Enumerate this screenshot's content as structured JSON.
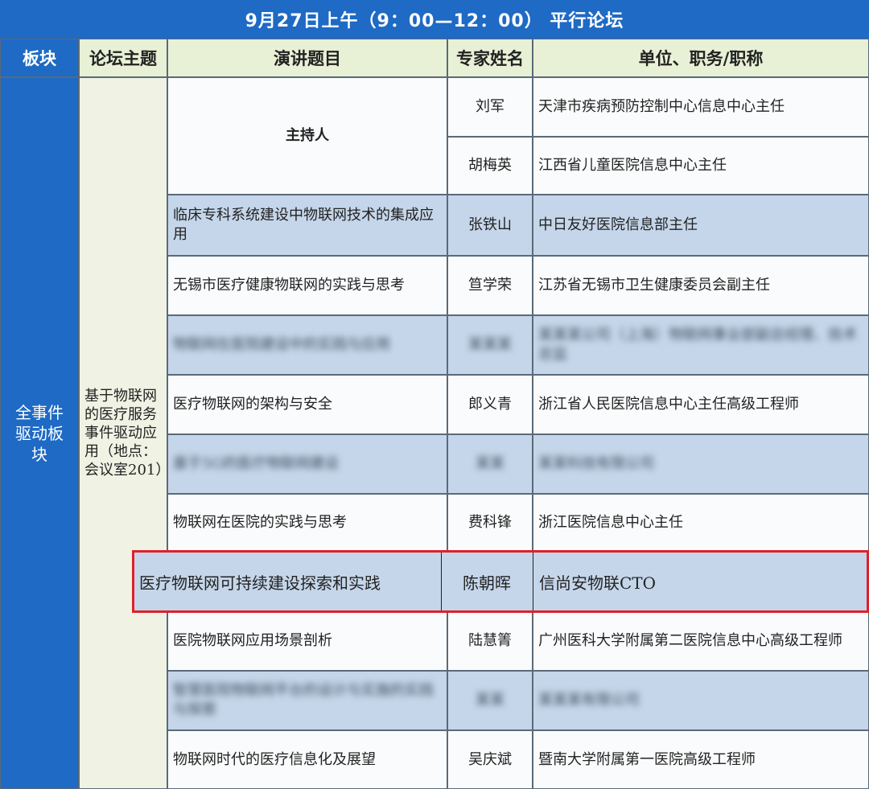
{
  "banner": "9月27日上午（9：00—12：00） 平行论坛",
  "headers": {
    "block": "板块",
    "theme": "论坛主题",
    "talk": "演讲题目",
    "expert": "专家姓名",
    "org": "单位、职务/职称"
  },
  "block_name": "全事件驱动板块",
  "forum_theme": "基于物联网的医疗服务事件驱动应用（地点：会议室201）",
  "host_label": "主持人",
  "rows": [
    {
      "talk": "",
      "name": "刘军",
      "org": "天津市疾病预防控制中心信息中心主任"
    },
    {
      "talk": "",
      "name": "胡梅英",
      "org": "江西省儿童医院信息中心主任"
    },
    {
      "talk": "临床专科系统建设中物联网技术的集成应用",
      "name": "张铁山",
      "org": "中日友好医院信息部主任"
    },
    {
      "talk": "无锡市医疗健康物联网的实践与思考",
      "name": "笪学荣",
      "org": "江苏省无锡市卫生健康委员会副主任"
    },
    {
      "talk": "物联网在医院建设中的实践与应用",
      "name": "某某某",
      "org": "某某某公司（上海）物联网事业部副总经理、技术总监"
    },
    {
      "talk": "医疗物联网的架构与安全",
      "name": "郎义青",
      "org": "浙江省人民医院信息中心主任高级工程师"
    },
    {
      "talk": "基于5G的医疗物联网建设",
      "name": "某某",
      "org": "某某科技有限公司"
    },
    {
      "talk": "物联网在医院的实践与思考",
      "name": "费科锋",
      "org": "浙江医院信息中心主任"
    },
    {
      "talk": "医疗物联网可持续建设探索和实践",
      "name": "陈朝晖",
      "org": "信尚安物联CTO"
    },
    {
      "talk": "医院物联网应用场景剖析",
      "name": "陆慧箐",
      "org": "广州医科大学附属第二医院信息中心高级工程师"
    },
    {
      "talk": "智慧医院物联网平台的设计与实施的实践与探索",
      "name": "某某",
      "org": "某某某有限公司"
    },
    {
      "talk": "物联网时代的医疗信息化及展望",
      "name": "吴庆斌",
      "org": "暨南大学附属第一医院高级工程师"
    }
  ]
}
